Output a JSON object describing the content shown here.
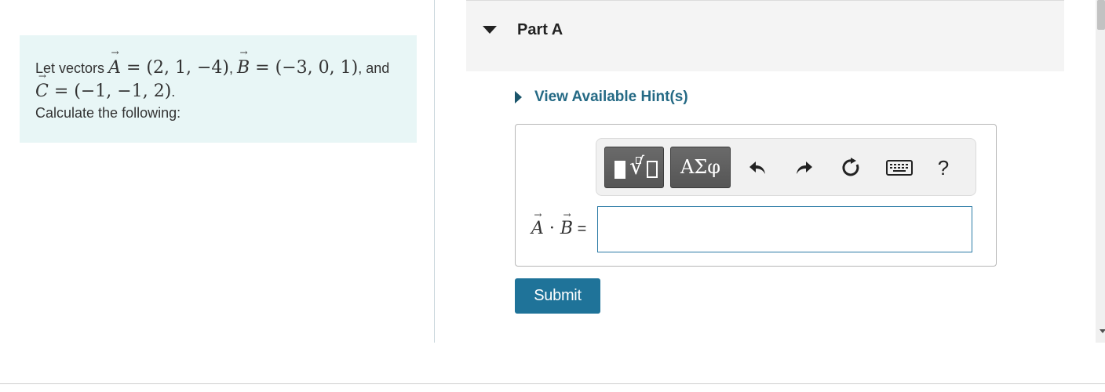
{
  "problem": {
    "intro": "Let vectors",
    "a_value": "(2, 1, −4)",
    "b_value": "(−3, 0, 1)",
    "and_text": ", and",
    "c_value": "(−1, −1, 2)",
    "instruction": "Calculate the following:",
    "vec_a": "A",
    "vec_b": "B",
    "vec_c": "C"
  },
  "part": {
    "title": "Part A"
  },
  "hint": {
    "label": "View Available Hint(s)"
  },
  "toolbar": {
    "greek_label": "ΑΣφ",
    "help_label": "?",
    "template_icon": "template-root-icon",
    "undo_icon": "undo-icon",
    "redo_icon": "redo-icon",
    "reset_icon": "reset-icon",
    "keyboard_icon": "keyboard-icon"
  },
  "answer": {
    "label_dot": "·",
    "label_equals": "=",
    "value": "",
    "placeholder": ""
  },
  "submit": {
    "label": "Submit"
  },
  "colors": {
    "problem_bg": "#e8f6f6",
    "accent": "#1f7399",
    "hint_text": "#256a85",
    "input_border": "#2a7aa5"
  }
}
